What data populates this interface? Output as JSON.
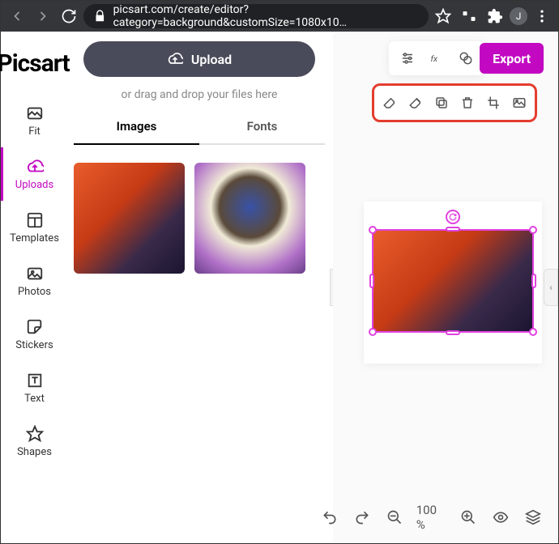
{
  "browser": {
    "url": "picsart.com/create/editor?category=background&customSize=1080x10…",
    "avatar_initial": "J"
  },
  "logo": "Picsart",
  "sidebar": {
    "items": [
      {
        "label": "Fit"
      },
      {
        "label": "Uploads"
      },
      {
        "label": "Templates"
      },
      {
        "label": "Photos"
      },
      {
        "label": "Stickers"
      },
      {
        "label": "Text"
      },
      {
        "label": "Shapes"
      }
    ],
    "active_index": 1
  },
  "panel": {
    "upload_label": "Upload",
    "drag_text": "or drag and drop your files here",
    "tabs": [
      "Images",
      "Fonts"
    ],
    "active_tab": 0
  },
  "top": {
    "export_label": "Export"
  },
  "canvas": {
    "zoom": "100 %"
  }
}
